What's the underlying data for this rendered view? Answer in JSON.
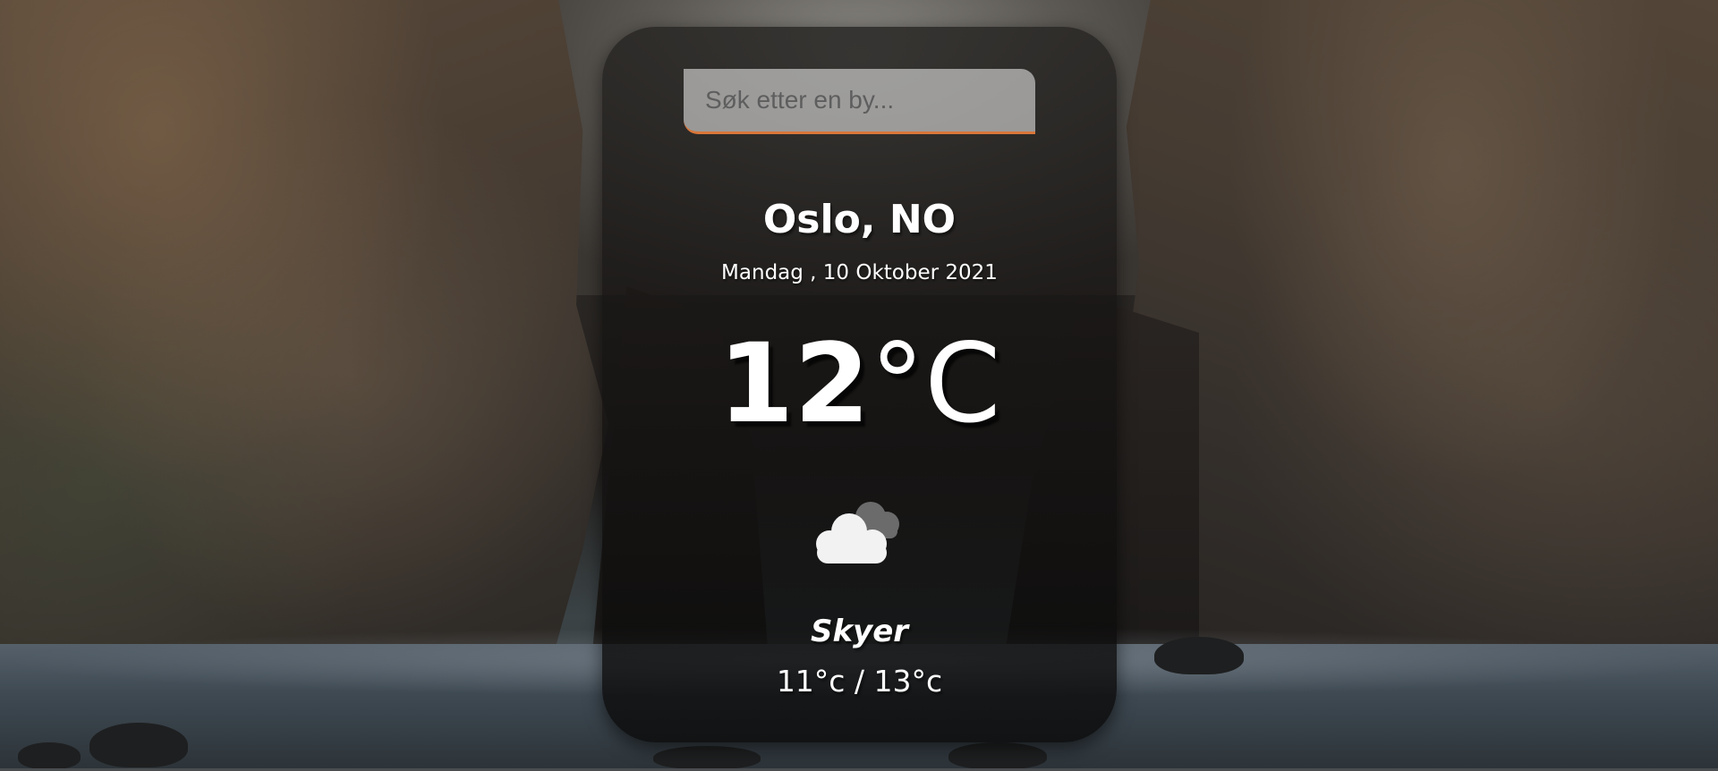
{
  "search": {
    "placeholder": "Søk etter en by...",
    "accent_color": "#d9763a"
  },
  "location": {
    "city_country": "Oslo, NO",
    "date": "Mandag , 10 Oktober 2021"
  },
  "current": {
    "temperature": "12",
    "unit": "°C",
    "icon": "cloud-icon",
    "condition": "Skyer",
    "low_high": "11°c / 13°c"
  },
  "background": {
    "image": "rocky-coastline-photo"
  }
}
